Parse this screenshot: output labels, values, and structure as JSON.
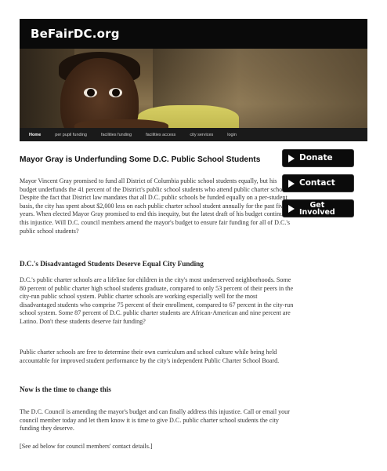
{
  "site": {
    "logo": "BeFairDC.org"
  },
  "nav": {
    "items": [
      {
        "label": "Home",
        "active": true
      },
      {
        "label": "per pupil funding",
        "active": false
      },
      {
        "label": "facilities funding",
        "active": false
      },
      {
        "label": "facilities access",
        "active": false
      },
      {
        "label": "city services",
        "active": false
      },
      {
        "label": "login",
        "active": false
      }
    ]
  },
  "article": {
    "title": "Mayor Gray is Underfunding Some D.C. Public School Students",
    "intro": "Mayor Vincent Gray promised to fund all District of Columbia public school students equally, but his budget underfunds the 41 percent of the District's public school students who attend public charter schools.  Despite the fact that District law mandates that all D.C. public schools be funded equally on a per-student basis, the city has spent about $2,000 less on each public charter school student annually for the past five years.  When elected Mayor Gray promised to end this inequity, but the latest draft of his budget continues this injustice.  Will D.C. council members amend the mayor's budget to ensure fair funding for all of D.C.'s public school students?",
    "heading1": "D.C.'s Disadvantaged Students Deserve Equal City Funding",
    "para2": "D.C.'s public charter schools are a lifeline for children in the city's most underserved neighborhoods.  Some 80 percent of public charter high school students graduate, compared to only 53 percent of their peers in the city-run public school system.  Public charter schools are working especially well for the most disadvantaged students who comprise 75 percent of their enrollment, compared to 67 percent in the city-run school system.  Some 87 percent of D.C. public charter students are African-American and nine percent are Latino.  Don't these students deserve fair funding?",
    "para3": "Public charter schools are free to determine their own curriculum and school culture while being held accountable for improved student performance by the city's independent Public Charter School Board.",
    "heading2": "Now is the time to change this",
    "para4": "The D.C. Council is amending the mayor's budget and can finally address this injustice.  Call or email your council member today and let them know it is time to give D.C. public charter school students the city funding they deserve.",
    "para5": "[See ad below for council members' contact details.]"
  },
  "sidebar": {
    "donate": "Donate",
    "contact": "Contact",
    "get_involved_line1": "Get",
    "get_involved_line2": "Involved"
  }
}
